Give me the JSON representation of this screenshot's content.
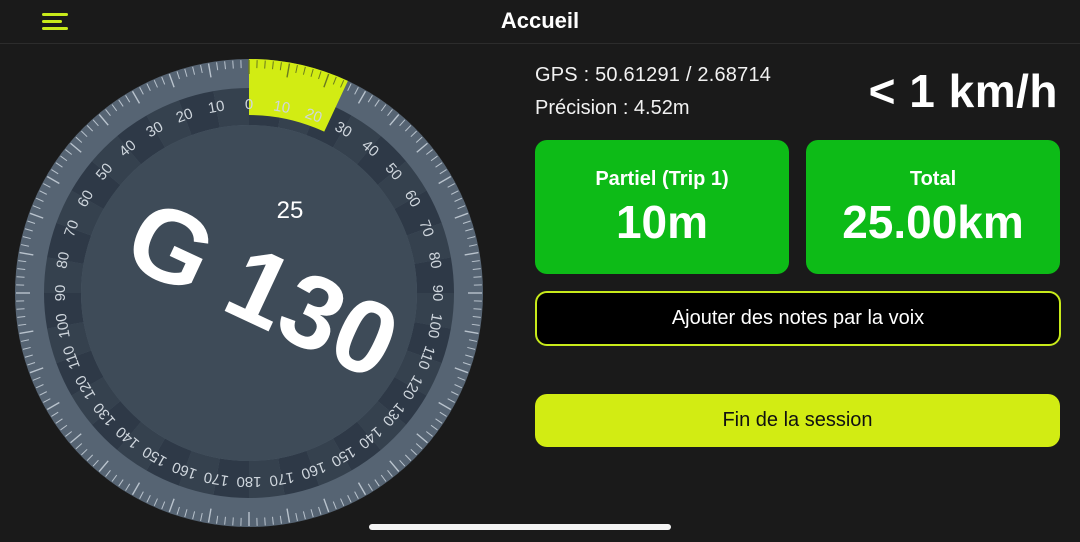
{
  "header": {
    "title": "Accueil",
    "menu_icon": "hamburger-menu-icon"
  },
  "compass": {
    "heading_label": "G 130",
    "distance_label": "25",
    "ring_labels": [
      "0",
      "10",
      "20",
      "30",
      "40",
      "50",
      "60",
      "70",
      "80",
      "90",
      "100",
      "110",
      "120",
      "130",
      "140",
      "150",
      "160",
      "170",
      "180",
      "170",
      "160",
      "150",
      "140",
      "130",
      "120",
      "110",
      "100",
      "90",
      "80",
      "70",
      "60",
      "50",
      "40",
      "30",
      "20",
      "10"
    ],
    "highlight_from": 0,
    "highlight_to": 25,
    "colors": {
      "face": "#3e4b58",
      "ring": "#2e3947",
      "ring_light": "#566473",
      "highlight": "#d2ec13"
    }
  },
  "gps": {
    "line": "GPS :  50.61291 / 2.68714",
    "precision": "Précision : 4.52m"
  },
  "speed": "< 1 km/h",
  "trip": {
    "label": "Partiel  (Trip 1)",
    "value": "10m"
  },
  "total": {
    "label": "Total",
    "value": "25.00km"
  },
  "buttons": {
    "notes": "Ajouter des notes par la voix",
    "end_session": "Fin de la session"
  },
  "colors": {
    "accent": "#d2ec13",
    "card_green": "#0dbb17",
    "background": "#1a1a1a"
  }
}
